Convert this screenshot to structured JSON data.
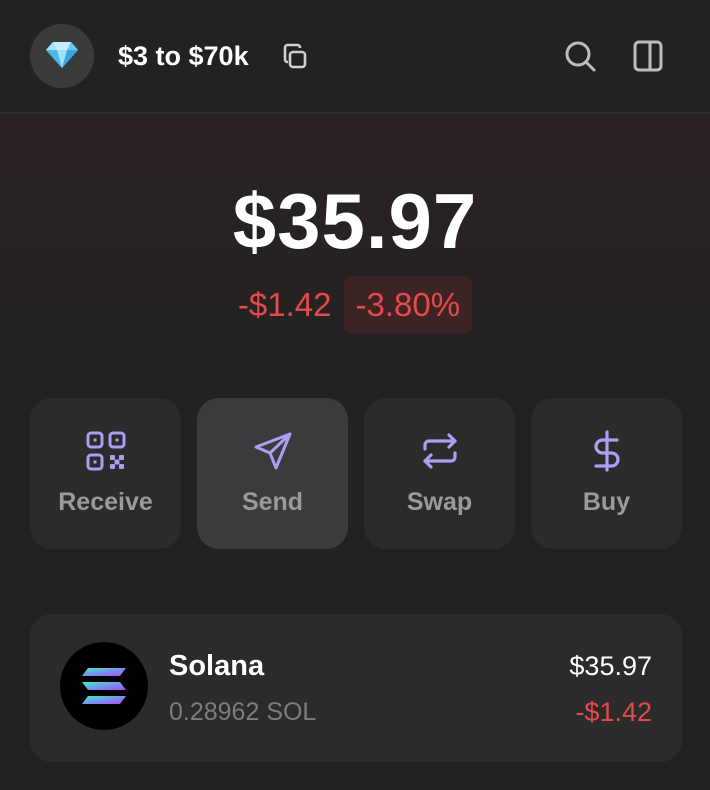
{
  "header": {
    "account_name": "$3 to $70k",
    "avatar_icon": "diamond-icon",
    "copy_icon": "copy-icon",
    "search_icon": "search-icon",
    "panel_icon": "side-panel-icon"
  },
  "balance": {
    "total": "$35.97",
    "change_value": "-$1.42",
    "change_percent": "-3.80%"
  },
  "actions": [
    {
      "label": "Receive",
      "icon": "qr-code-icon"
    },
    {
      "label": "Send",
      "icon": "send-icon"
    },
    {
      "label": "Swap",
      "icon": "swap-icon"
    },
    {
      "label": "Buy",
      "icon": "dollar-icon"
    }
  ],
  "tokens": [
    {
      "name": "Solana",
      "amount": "0.28962 SOL",
      "value": "$35.97",
      "change": "-$1.42",
      "icon": "solana-logo-icon"
    }
  ],
  "colors": {
    "accent": "#ab9ff2",
    "negative": "#e5484d",
    "background": "#222222",
    "card": "#2b2b2b"
  }
}
